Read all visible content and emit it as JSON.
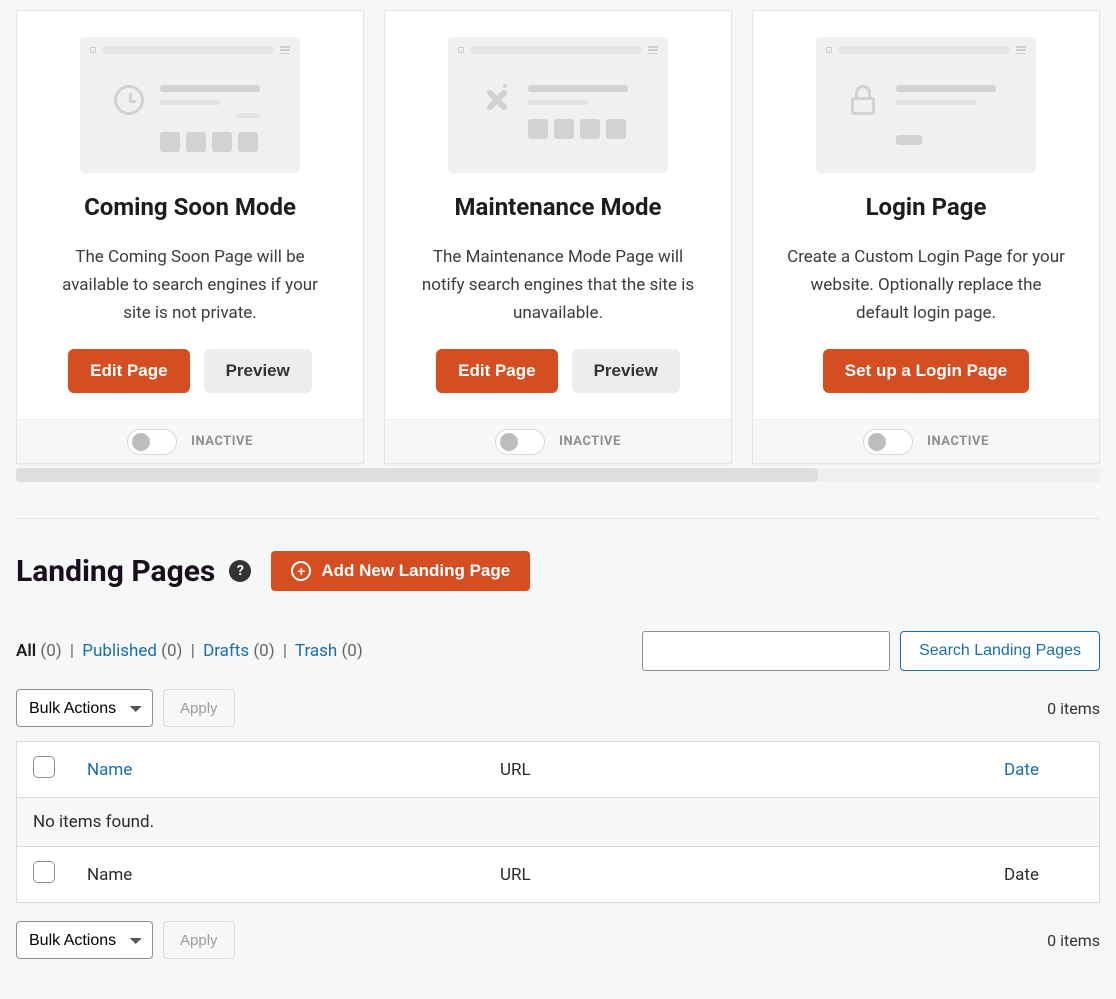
{
  "cards": [
    {
      "title": "Coming Soon Mode",
      "desc": "The Coming Soon Page will be available to search engines if your site is not private.",
      "primary": "Edit Page",
      "secondary": "Preview",
      "status": "INACTIVE"
    },
    {
      "title": "Maintenance Mode",
      "desc": "The Maintenance Mode Page will notify search engines that the site is unavailable.",
      "primary": "Edit Page",
      "secondary": "Preview",
      "status": "INACTIVE"
    },
    {
      "title": "Login Page",
      "desc": "Create a Custom Login Page for your website. Optionally replace the default login page.",
      "primary": "Set up a Login Page",
      "secondary": null,
      "status": "INACTIVE"
    }
  ],
  "landing": {
    "title": "Landing Pages",
    "add_new": "Add New Landing Page",
    "filters": {
      "all": "All",
      "all_count": "(0)",
      "published": "Published",
      "published_count": "(0)",
      "drafts": "Drafts",
      "drafts_count": "(0)",
      "trash": "Trash",
      "trash_count": "(0)"
    },
    "search_btn": "Search Landing Pages",
    "bulk_select": "Bulk Actions",
    "apply": "Apply",
    "items_count": "0 items",
    "columns": {
      "name": "Name",
      "url": "URL",
      "date": "Date"
    },
    "empty": "No items found."
  }
}
